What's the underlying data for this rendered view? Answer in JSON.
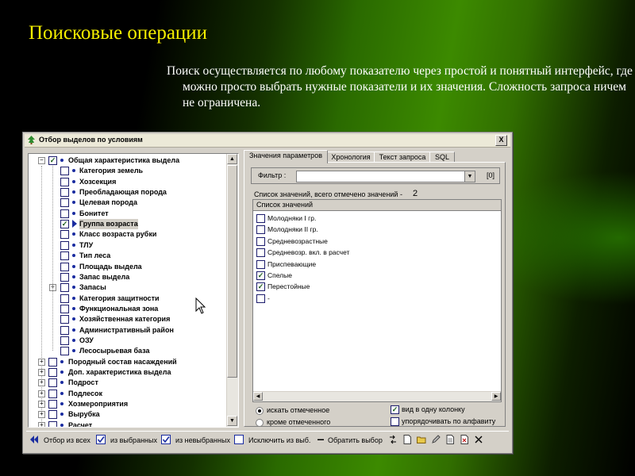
{
  "slide": {
    "title": "Поисковые операции",
    "text": "Поиск осуществляется по любому показателю через простой и понятный интерфейс, где можно просто выбрать нужные показатели и их значения. Сложность запроса ничем не ограничена."
  },
  "window": {
    "title": "Отбор выделов по условиям",
    "close_label": "X"
  },
  "tree": {
    "root": {
      "label": "Общая характеристика выдела",
      "checked": true
    },
    "children": [
      {
        "label": "Категория земель",
        "checked": false
      },
      {
        "label": "Хозсекция",
        "checked": false
      },
      {
        "label": "Преобладающая порода",
        "checked": false
      },
      {
        "label": "Целевая порода",
        "checked": false
      },
      {
        "label": "Бонитет",
        "checked": false
      },
      {
        "label": "Группа возраста",
        "checked": true,
        "selected": true
      },
      {
        "label": "Класс возраста рубки",
        "checked": false
      },
      {
        "label": "ТЛУ",
        "checked": false
      },
      {
        "label": "Тип леса",
        "checked": false
      },
      {
        "label": "Площадь выдела",
        "checked": false
      },
      {
        "label": "Запас выдела",
        "checked": false
      },
      {
        "label": "Запасы",
        "checked": false,
        "expandable": true
      },
      {
        "label": "Категория защитности",
        "checked": false
      },
      {
        "label": "Функциональная зона",
        "checked": false
      },
      {
        "label": "Хозяйственная категория",
        "checked": false
      },
      {
        "label": "Административный район",
        "checked": false
      },
      {
        "label": "ОЗУ",
        "checked": false
      },
      {
        "label": "Лесосырьевая база",
        "checked": false
      }
    ],
    "siblings": [
      {
        "label": "Породный состав насаждений"
      },
      {
        "label": "Доп. характеристика выдела"
      },
      {
        "label": "Подрост"
      },
      {
        "label": "Подлесок"
      },
      {
        "label": "Хозмероприятия"
      },
      {
        "label": "Вырубка"
      },
      {
        "label": "Расчет"
      }
    ]
  },
  "tabs": [
    {
      "label": "Значения параметров",
      "active": true
    },
    {
      "label": "Хронология"
    },
    {
      "label": "Текст запроса"
    },
    {
      "label": "SQL"
    }
  ],
  "filter": {
    "label": "Фильтр :",
    "value": "",
    "count": "[0]"
  },
  "summary": {
    "text": "Список значений, всего отмечено значений -",
    "count": "2"
  },
  "values_list": {
    "header": "Список значений",
    "items": [
      {
        "label": "Молодняки I гр.",
        "checked": false
      },
      {
        "label": "Молодняки II гр.",
        "checked": false
      },
      {
        "label": "Средневозрастные",
        "checked": false
      },
      {
        "label": "Средневозр. вкл. в расчет",
        "checked": false
      },
      {
        "label": "Приспевающие",
        "checked": false
      },
      {
        "label": "Спелые",
        "checked": true
      },
      {
        "label": "Перестойные",
        "checked": true
      },
      {
        "label": "-",
        "checked": false
      }
    ]
  },
  "options": {
    "search_checked": "искать отмеченное",
    "except_checked": "кроме отмеченного",
    "one_column": "вид в одну колонку",
    "sort_alpha": "упорядочивать по алфавиту"
  },
  "toolbar": {
    "select_all": "Отбор из всех",
    "from_selected": "из выбранных",
    "from_unselected": "из невыбранных",
    "exclude": "Исключить из выб.",
    "invert": "Обратить выбор"
  },
  "colors": {
    "title_yellow": "#f5ef00",
    "window_face": "#d4d0c8",
    "tree_bullet": "#1a2ca0"
  }
}
